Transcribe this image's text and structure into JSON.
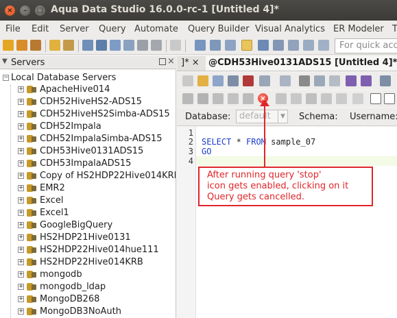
{
  "window": {
    "title": "Aqua Data Studio 16.0.0-rc-1 [Untitled 4]*",
    "close_glyph": "×",
    "min_glyph": "–",
    "max_glyph": "□"
  },
  "menu": [
    {
      "label": "File"
    },
    {
      "label": "Edit"
    },
    {
      "label": "Server"
    },
    {
      "label": "Query"
    },
    {
      "label": "Automate"
    },
    {
      "label": "Query Builder"
    },
    {
      "label": "Visual Analytics"
    },
    {
      "label": "ER Modeler"
    },
    {
      "label": "T"
    }
  ],
  "toolbar": {
    "search_placeholder": "For quick acc"
  },
  "servers_panel": {
    "title": "Servers",
    "root_label": "Local Database Servers",
    "items": [
      "ApacheHive014",
      "CDH52HiveHS2-ADS15",
      "CDH52HiveHS2Simba-ADS15",
      "CDH52Impala",
      "CDH52ImpalaSimba-ADS15",
      "CDH53Hive0131ADS15",
      "CDH53ImpalaADS15",
      "Copy of HS2HDP22Hive014KRB",
      "EMR2",
      "Excel",
      "Excel1",
      "GoogleBigQuery",
      "HS2HDP21Hive0131",
      "HS2HDP22Hive014hue111",
      "HS2HDP22Hive014KRB",
      "mongodb",
      "mongodb_ldap",
      "MongoDB268",
      "MongoDB3NoAuth"
    ]
  },
  "tabs": {
    "prev_tab": "]*",
    "active_tab": "@CDH53Hive0131ADS15 [Untitled 4]*"
  },
  "dbbar": {
    "database_label": "Database:",
    "database_value": "default",
    "schema_label": "Schema:",
    "username_label": "Username:"
  },
  "editor": {
    "line_numbers": [
      "1",
      "2",
      "3",
      "4"
    ],
    "line2_kw1": "SELECT",
    "line2_mid": " * ",
    "line2_kw2": "FROM",
    "line2_rest": " sample_07",
    "line3": "GO"
  },
  "annotation": {
    "lines": [
      "After running query 'stop'",
      "icon gets enabled, clicking on it",
      "Query gets cancelled."
    ],
    "color": "#e0252a"
  },
  "stop_icon": "stop-icon"
}
